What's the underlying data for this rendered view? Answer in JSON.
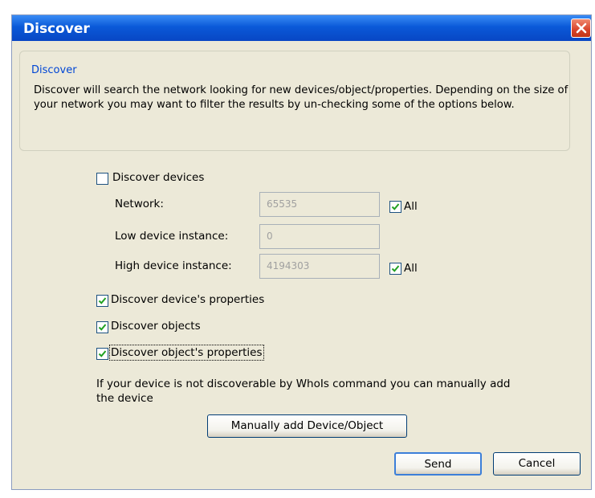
{
  "window": {
    "title": "Discover"
  },
  "group": {
    "legend": "Discover",
    "description": "Discover will search the network looking for new devices/object/properties. Depending on the size of your network you may want to filter the results by un-checking some of the options below."
  },
  "options": {
    "discover_devices": {
      "label": "Discover devices",
      "checked": false
    },
    "network": {
      "label": "Network:",
      "value": "65535",
      "all_label": "All",
      "all_checked": true
    },
    "low_instance": {
      "label": "Low device instance:",
      "value": "0"
    },
    "high_instance": {
      "label": "High device instance:",
      "value": "4194303",
      "all_label": "All",
      "all_checked": true
    },
    "device_properties": {
      "label": "Discover device's properties",
      "checked": true
    },
    "objects": {
      "label": "Discover objects",
      "checked": true
    },
    "object_properties": {
      "label": "Discover object's properties",
      "checked": true
    }
  },
  "note": "If your device is not discoverable by WhoIs command you can manually add the device",
  "buttons": {
    "manual_add": "Manually add Device/Object",
    "send": "Send",
    "cancel": "Cancel"
  }
}
